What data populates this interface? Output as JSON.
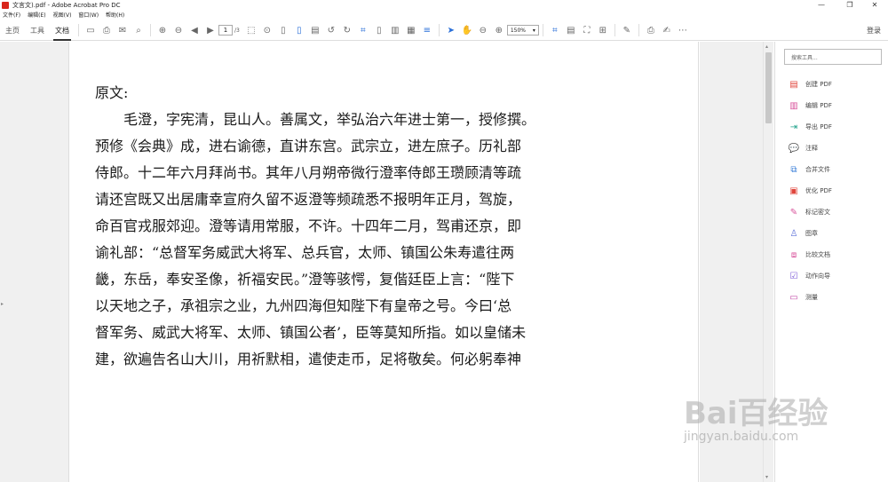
{
  "window": {
    "title": "文言文).pdf - Adobe Acrobat Pro DC",
    "minimize": "—",
    "maximize": "❐",
    "close": "✕"
  },
  "menu": [
    "文件(F)",
    "编辑(E)",
    "视图(V)",
    "窗口(W)",
    "帮助(H)"
  ],
  "tabs": [
    "主页",
    "工具",
    "文档"
  ],
  "toolbar": {
    "page_current": "1",
    "page_total": "/3",
    "zoom": "150%",
    "zoom_arrow": "▾",
    "login": "登录"
  },
  "document": {
    "lines": [
      "原文:",
      "毛澄，字宪清，昆山人。善属文，举弘治六年进士第一，授修撰。",
      "预修《会典》成，进右谕德，直讲东宫。武宗立，进左庶子。历礼部",
      "侍郎。十二年六月拜尚书。其年八月朔帝微行澄率侍郎王瓒顾清等疏",
      "请还宫既又出居庸幸宣府久留不返澄等频疏悉不报明年正月，驾旋，",
      "命百官戎服郊迎。澄等请用常服，不许。十四年二月，驾甫还京，即",
      "谕礼部：“总督军务威武大将军、总兵官，太师、镇国公朱寿遣往两",
      "畿，东岳，奉安圣像，祈福安民。”澄等骇愕，复偕廷臣上言：“陛下",
      "以天地之子，承祖宗之业，九州四海但知陛下有皇帝之号。今曰‘总",
      "督军务、威武大将军、太师、镇国公者’，臣等莫知所指。如以皇储未",
      "建，欲遍告名山大川，用祈默相，遣使走币，足将敬矣。何必躬奉神"
    ]
  },
  "tools_pane": {
    "search_placeholder": "搜索工具...",
    "items": [
      {
        "label": "创建 PDF",
        "icon": "create-pdf-icon",
        "color": "#e0463c"
      },
      {
        "label": "编辑 PDF",
        "icon": "edit-pdf-icon",
        "color": "#d8539b"
      },
      {
        "label": "导出 PDF",
        "icon": "export-pdf-icon",
        "color": "#23a38c"
      },
      {
        "label": "注释",
        "icon": "comment-icon",
        "color": "#f2b623"
      },
      {
        "label": "合并文件",
        "icon": "combine-files-icon",
        "color": "#3b7fd8"
      },
      {
        "label": "优化 PDF",
        "icon": "optimize-pdf-icon",
        "color": "#e0463c"
      },
      {
        "label": "标记密文",
        "icon": "redact-icon",
        "color": "#d8539b"
      },
      {
        "label": "图章",
        "icon": "stamp-icon",
        "color": "#5b6fd8"
      },
      {
        "label": "比较文档",
        "icon": "compare-icon",
        "color": "#d8539b"
      },
      {
        "label": "动作向导",
        "icon": "action-wizard-icon",
        "color": "#7d5bd8"
      },
      {
        "label": "测量",
        "icon": "measure-icon",
        "color": "#c24ba8"
      }
    ]
  },
  "watermark": {
    "main": "Bai百经验",
    "sub": "jingyan.baidu.com"
  }
}
